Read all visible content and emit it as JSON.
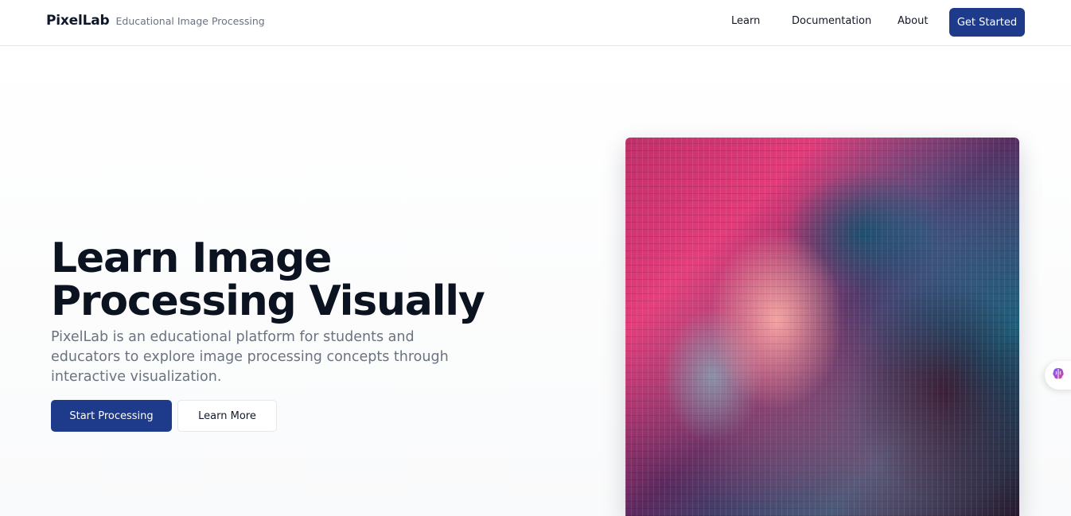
{
  "header": {
    "brand_name": "PixelLab",
    "brand_tagline": "Educational Image Processing",
    "nav": {
      "learn": "Learn",
      "documentation": "Documentation",
      "about": "About"
    },
    "cta_label": "Get Started"
  },
  "hero": {
    "title": "Learn Image Processing Visually",
    "description": "PixelLab is an educational platform for students and educators to explore image processing concepts through interactive visualization.",
    "primary_button": "Start Processing",
    "secondary_button": "Learn More"
  },
  "icons": {
    "side_widget": "brain-icon"
  },
  "colors": {
    "primary": "#1e3a8a",
    "text_dark": "#0b1220",
    "text_muted": "#6b7280"
  }
}
